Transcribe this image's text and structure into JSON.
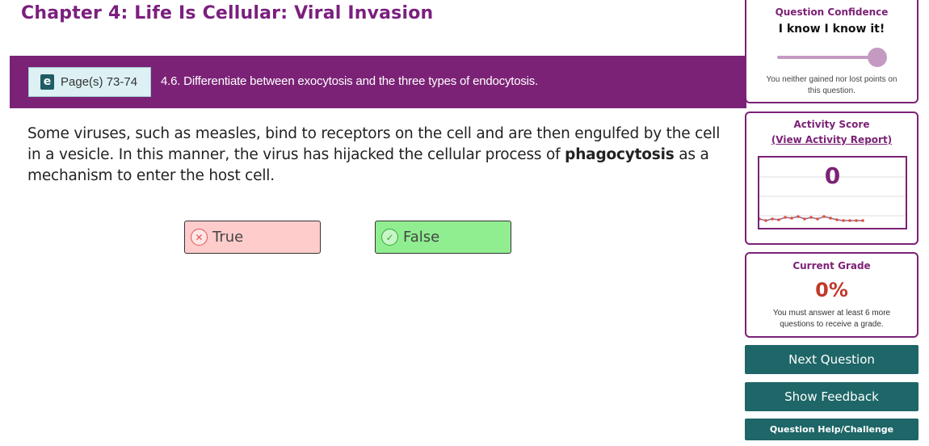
{
  "header": {
    "chapter_title": "Chapter 4: Life Is Cellular: Viral Invasion"
  },
  "objective_bar": {
    "ebook_icon": "e",
    "pages_label": "Page(s) 73-74",
    "objective_text": "4.6. Differentiate between exocytosis and the three types of endocytosis."
  },
  "question": {
    "text_before": "Some viruses, such as measles, bind to receptors on the cell and are then engulfed by the cell in a vesicle. In this manner, the virus has hijacked the cellular process of ",
    "bold_term": "phagocytosis",
    "text_after": " as a mechanism to enter the host cell."
  },
  "answers": [
    {
      "label": "True",
      "icon": "x-circle-icon",
      "state": "incorrect",
      "color": "#ffcccc"
    },
    {
      "label": "False",
      "icon": "check-circle-icon",
      "state": "correct",
      "color": "#90ee90"
    }
  ],
  "confidence": {
    "title": "Question Confidence",
    "value": "I know I know it!",
    "slider_level": 1.0,
    "note": "You neither gained nor lost points on this question."
  },
  "activity_score": {
    "title": "Activity Score",
    "report_link": "(View Activity Report)",
    "score": "0"
  },
  "current_grade": {
    "title": "Current Grade",
    "value": "0%",
    "note": "You must answer at least 6 more questions to receive a grade."
  },
  "buttons": {
    "next": "Next Question",
    "feedback": "Show Feedback",
    "help": "Question Help/Challenge"
  },
  "colors": {
    "brand_purple": "#7b2276",
    "teal": "#1e6667",
    "grade_red": "#c0392b"
  }
}
